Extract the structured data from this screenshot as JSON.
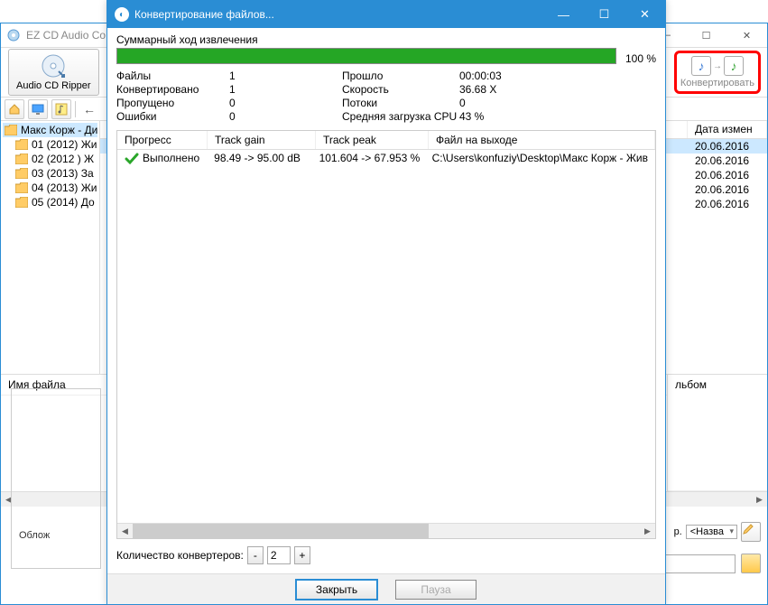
{
  "main_window": {
    "title": "EZ CD Audio Co",
    "ripper_label": "Audio CD Ripper",
    "convert_label": "Конвертировать",
    "tree": {
      "root": "Макс Корж - Ди",
      "children": [
        "01 (2012) Жи",
        "02 (2012 ) Ж",
        "03 (2013) За",
        "04 (2013) Жи",
        "05 (2014) До"
      ]
    },
    "date_header": "Дата измен",
    "dates": [
      "20.06.2016",
      "20.06.2016",
      "20.06.2016",
      "20.06.2016",
      "20.06.2016"
    ],
    "filename_header": "Имя файла",
    "album_header": "льбом",
    "cover_label": "Облож",
    "format_prefix": "р.",
    "format_value": "<Назва",
    "icons": {
      "home": "home-icon",
      "monitor": "monitor-icon",
      "music": "music-icon",
      "back": "back-icon"
    }
  },
  "dialog": {
    "title": "Конвертирование файлов...",
    "summary_label": "Суммарный ход извлечения",
    "progress_pct": "100 %",
    "stats": {
      "files_label": "Файлы",
      "files_value": "1",
      "elapsed_label": "Прошло",
      "elapsed_value": "00:00:03",
      "converted_label": "Конвертировано",
      "converted_value": "1",
      "speed_label": "Скорость",
      "speed_value": "36.68 X",
      "skipped_label": "Пропущено",
      "skipped_value": "0",
      "threads_label": "Потоки",
      "threads_value": "0",
      "errors_label": "Ошибки",
      "errors_value": "0",
      "cpu_label": "Средняя загрузка CPU",
      "cpu_value": "43 %"
    },
    "columns": {
      "progress": "Прогресс",
      "gain": "Track gain",
      "peak": "Track peak",
      "output": "Файл на выходе"
    },
    "row": {
      "status": "Выполнено",
      "gain": "98.49 -> 95.00 dB",
      "peak": "101.604 -> 67.953 %",
      "output": "C:\\Users\\konfuziy\\Desktop\\Макс Корж - Жив"
    },
    "converters_label": "Количество конвертеров:",
    "converters_value": "2",
    "close_btn": "Закрыть",
    "pause_btn": "Пауза"
  }
}
